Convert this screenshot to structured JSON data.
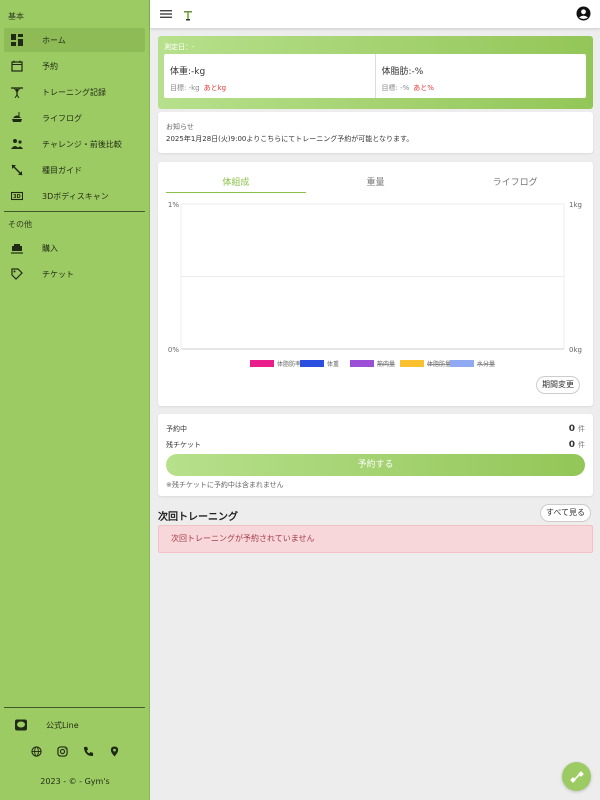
{
  "sidebar": {
    "section_basic": "基本",
    "items": [
      {
        "label": "ホーム",
        "icon": "dashboard-icon"
      },
      {
        "label": "予約",
        "icon": "calendar-edit-icon"
      },
      {
        "label": "トレーニング記録",
        "icon": "weight-lifting-icon"
      },
      {
        "label": "ライフログ",
        "icon": "meal-icon"
      },
      {
        "label": "チャレンジ・前後比較",
        "icon": "group-icon"
      },
      {
        "label": "種目ガイド",
        "icon": "expand-arrows-icon"
      },
      {
        "label": "3Dボディスキャン",
        "icon": "scan-3d-icon"
      }
    ],
    "section_other": "その他",
    "other_items": [
      {
        "label": "購入",
        "icon": "cart-icon"
      },
      {
        "label": "チケット",
        "icon": "ticket-icon"
      }
    ],
    "line_label": "公式Line",
    "copyright": "2023 - © - Gym's"
  },
  "measurement": {
    "date_label": "測定日：-",
    "weight": "体重:-kg",
    "weight_target": "目標: -kg",
    "weight_remaining": "あとkg",
    "fat": "体脂肪:-%",
    "fat_target": "目標: -%",
    "fat_remaining": "あと%"
  },
  "notice": {
    "title": "お知らせ",
    "body": "2025年1月28日(火)9:00よりこちらにてトレーニング予約が可能となります。"
  },
  "chart_tabs": [
    "体組成",
    "重量",
    "ライフログ"
  ],
  "period_button": "期間変更",
  "chart_data": {
    "type": "line",
    "x": [],
    "series": [
      {
        "name": "体脂肪率",
        "color": "#e91e8c",
        "values": [],
        "hidden": false
      },
      {
        "name": "体重",
        "color": "#2a4ee0",
        "values": [],
        "hidden": false
      },
      {
        "name": "筋肉量",
        "color": "#9b4fd6",
        "values": [],
        "hidden": true
      },
      {
        "name": "体脂肪量",
        "color": "#fbc02d",
        "values": [],
        "hidden": true
      },
      {
        "name": "水分量",
        "color": "#8fa9f2",
        "values": [],
        "hidden": true
      }
    ],
    "y_left": {
      "ticks": [
        "0%",
        "1%"
      ],
      "range": [
        0,
        1
      ]
    },
    "y_right": {
      "ticks": [
        "0kg",
        "1kg"
      ],
      "range": [
        0,
        1
      ]
    },
    "grid": true,
    "legend": "bottom"
  },
  "reservation": {
    "booked_label": "予約中",
    "booked_count": "0",
    "tickets_label": "残チケット",
    "tickets_count": "0",
    "unit": "件",
    "button": "予約する",
    "note": "※残チケットに予約中は含まれません"
  },
  "next_training": {
    "title": "次回トレーニング",
    "see_all": "すべて見る",
    "empty_message": "次回トレーニングが予約されていません"
  },
  "colors": {
    "sidebar": "#9dcb63",
    "accent": "#8bc34a",
    "alert_bg": "#f8d7da",
    "alert_text": "#a33d46",
    "warn": "#e53935"
  }
}
